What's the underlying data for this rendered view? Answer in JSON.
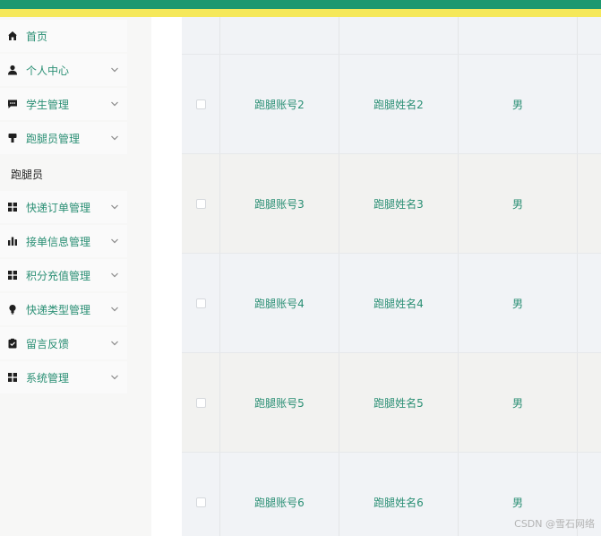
{
  "colors": {
    "accent": "#2a8f74",
    "topbar_green": "#1d9870",
    "topbar_yellow": "#f5e85a",
    "row_even": "#f1f3f6",
    "row_odd": "#f2f2f0"
  },
  "sidebar": {
    "items": [
      {
        "label": "首页",
        "icon": "home-icon",
        "expandable": false
      },
      {
        "label": "个人中心",
        "icon": "user-icon",
        "expandable": true
      },
      {
        "label": "学生管理",
        "icon": "chat-icon",
        "expandable": true
      },
      {
        "label": "跑腿员管理",
        "icon": "runner-icon",
        "expandable": true
      },
      {
        "label": "快递订单管理",
        "icon": "grid-icon",
        "expandable": true
      },
      {
        "label": "接单信息管理",
        "icon": "bar-chart-icon",
        "expandable": true
      },
      {
        "label": "积分充值管理",
        "icon": "grid-icon",
        "expandable": true
      },
      {
        "label": "快递类型管理",
        "icon": "bulb-icon",
        "expandable": true
      },
      {
        "label": "留言反馈",
        "icon": "clipboard-icon",
        "expandable": true
      },
      {
        "label": "系统管理",
        "icon": "grid-icon",
        "expandable": true
      }
    ],
    "submenu": {
      "label": "跑腿员"
    }
  },
  "table": {
    "rows": [
      {
        "account": "",
        "name": "",
        "gender": ""
      },
      {
        "account": "跑腿账号2",
        "name": "跑腿姓名2",
        "gender": "男"
      },
      {
        "account": "跑腿账号3",
        "name": "跑腿姓名3",
        "gender": "男"
      },
      {
        "account": "跑腿账号4",
        "name": "跑腿姓名4",
        "gender": "男"
      },
      {
        "account": "跑腿账号5",
        "name": "跑腿姓名5",
        "gender": "男"
      },
      {
        "account": "跑腿账号6",
        "name": "跑腿姓名6",
        "gender": "男"
      }
    ]
  },
  "watermark": "CSDN @雪石网络"
}
